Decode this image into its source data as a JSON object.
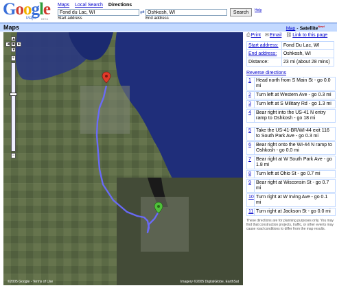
{
  "logo": {
    "word": "Google",
    "sub": "Maps",
    "beta": "BETA"
  },
  "nav": {
    "link1": "Maps",
    "link2": "Local Search",
    "current": "Directions"
  },
  "form": {
    "start_value": "Fond du Lac, WI",
    "end_value": "Oshkosh, WI",
    "start_label": "Start address",
    "end_label": "End address",
    "search_label": "Search",
    "help_label": "Help"
  },
  "titlebar": {
    "title": "Maps",
    "map_label": "Map",
    "sep": "-",
    "satellite_label": "Satellite",
    "new_badge": "New!"
  },
  "actions": {
    "print": "Print",
    "email": "Email",
    "link": "Link to this page"
  },
  "summary": {
    "start_label": "Start address:",
    "start_value": "Fond Du Lac, WI",
    "end_label": "End address:",
    "end_value": "Oshkosh, WI",
    "distance_label": "Distance:",
    "distance_value": "23 mi (about 28 mins)"
  },
  "reverse_label": "Reverse directions",
  "steps_a": [
    {
      "n": "1",
      "text": "Head north from S Main St - go 0.0 mi"
    },
    {
      "n": "2",
      "text": "Turn left at Western Ave - go 0.3 mi"
    },
    {
      "n": "3",
      "text": "Turn left at S Military Rd - go 1.3 mi"
    },
    {
      "n": "4",
      "text": "Bear right into the US-41 N entry ramp to Oshkosh - go 18 mi"
    }
  ],
  "steps_b": [
    {
      "n": "5",
      "text": "Take the US-41-BR/WI-44 exit 116 to South Park Ave - go 0.3 mi"
    },
    {
      "n": "6",
      "text": "Bear right onto the WI-44 N ramp to Oshkosh - go 0.0 mi"
    },
    {
      "n": "7",
      "text": "Bear right at W South Park Ave - go 1.8 mi"
    },
    {
      "n": "8",
      "text": "Turn left at Ohio St - go 0.7 mi"
    },
    {
      "n": "9",
      "text": "Bear right at Wisconsin St - go 0.7 mi"
    },
    {
      "n": "10",
      "text": "Turn right at W Irving Ave - go 0.1 mi"
    },
    {
      "n": "11",
      "text": "Turn right at Jackson St - go 0.0 mi"
    }
  ],
  "disclaimer": "These directions are for planning purposes only. You may find that construction projects, traffic, or other events may cause road conditions to differ from the map results.",
  "map": {
    "copyright_left": "©2005 Google - Terms of Use",
    "copyright_right": "Imagery ©2005 DigitalGlobe, EarthSat",
    "controls": {
      "up": "▲",
      "left": "◄",
      "center": "■",
      "right": "►",
      "down": "▼",
      "zoom_in": "+",
      "zoom_out": "−"
    }
  },
  "colors": {
    "water": "#1f2e7a",
    "land": "#5b6a45",
    "route": "#6a6aff",
    "header_bar": "#c3d9ff",
    "link": "#0000cc"
  }
}
